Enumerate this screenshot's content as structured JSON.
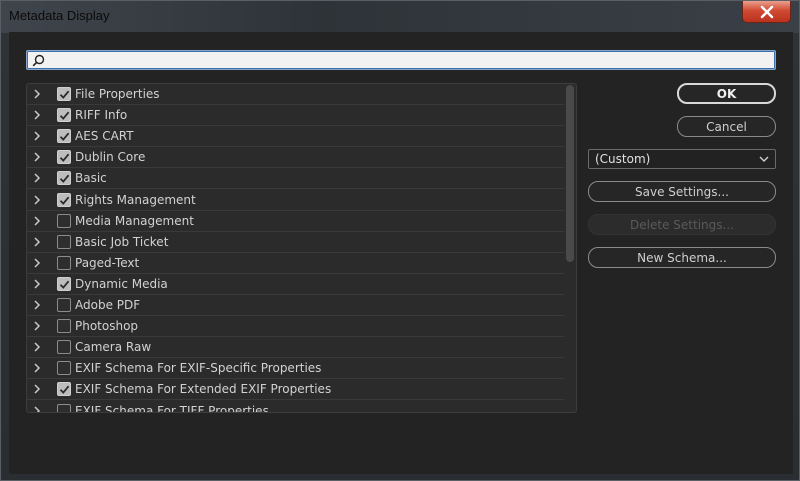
{
  "window": {
    "title": "Metadata Display",
    "close_glyph": "✕"
  },
  "search": {
    "value": "",
    "placeholder": ""
  },
  "list": {
    "items": [
      {
        "label": "File Properties",
        "checked": true
      },
      {
        "label": "RIFF Info",
        "checked": true
      },
      {
        "label": "AES CART",
        "checked": true
      },
      {
        "label": "Dublin Core",
        "checked": true
      },
      {
        "label": "Basic",
        "checked": true
      },
      {
        "label": "Rights Management",
        "checked": true
      },
      {
        "label": "Media Management",
        "checked": false
      },
      {
        "label": "Basic Job Ticket",
        "checked": false
      },
      {
        "label": "Paged-Text",
        "checked": false
      },
      {
        "label": "Dynamic Media",
        "checked": true
      },
      {
        "label": "Adobe PDF",
        "checked": false
      },
      {
        "label": "Photoshop",
        "checked": false
      },
      {
        "label": "Camera Raw",
        "checked": false
      },
      {
        "label": "EXIF Schema For EXIF-Specific Properties",
        "checked": false
      },
      {
        "label": "EXIF Schema For Extended EXIF Properties",
        "checked": true
      },
      {
        "label": "EXIF Schema For TIFF Properties",
        "checked": false
      }
    ]
  },
  "buttons": {
    "ok": "OK",
    "cancel": "Cancel",
    "save_settings": "Save Settings...",
    "delete_settings": "Delete Settings...",
    "new_schema": "New Schema..."
  },
  "preset": {
    "selected": "(Custom)"
  },
  "colors": {
    "accent_focus": "#3b6fb0",
    "close_red": "#d14a33",
    "panel_bg": "#232323"
  }
}
